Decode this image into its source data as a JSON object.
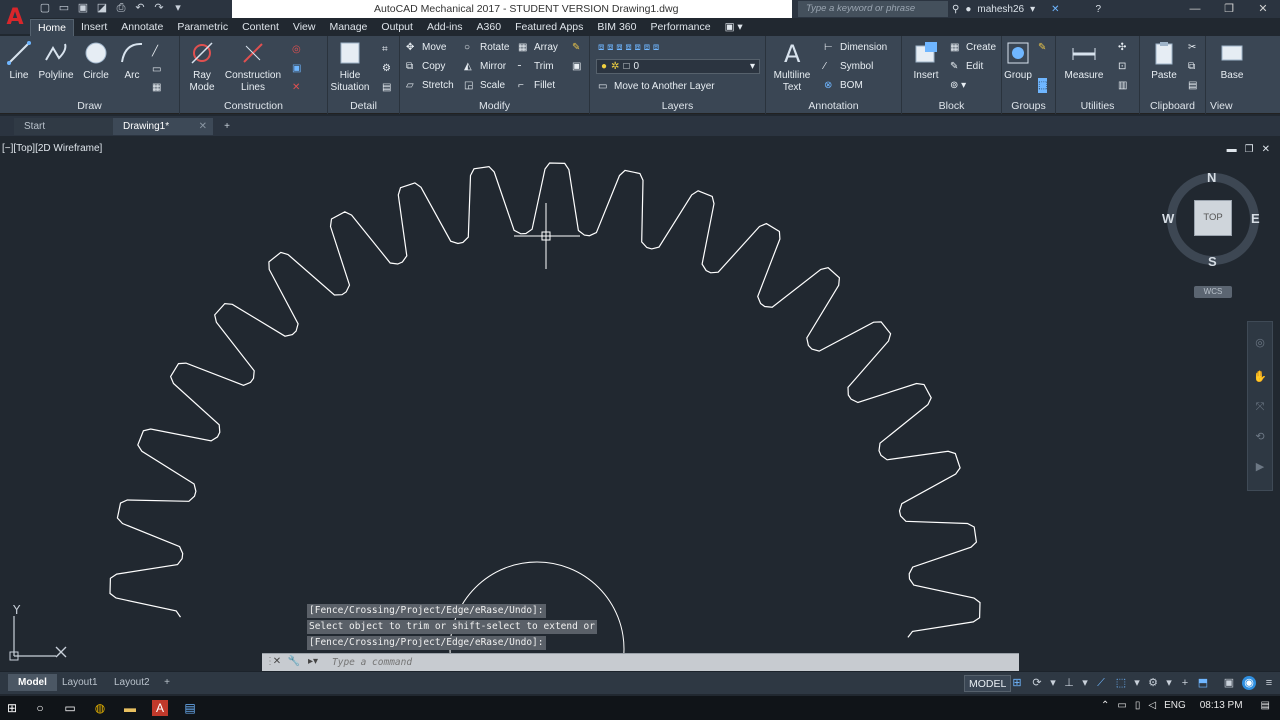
{
  "titlebar": {
    "title": "AutoCAD Mechanical 2017 - STUDENT VERSION    Drawing1.dwg",
    "search_placeholder": "Type a keyword or phrase",
    "username": "mahesh26",
    "app_logo_letter": "A"
  },
  "ribbon_tabs": [
    "Home",
    "Insert",
    "Annotate",
    "Parametric",
    "Content",
    "View",
    "Manage",
    "Output",
    "Add-ins",
    "A360",
    "Featured Apps",
    "BIM 360",
    "Performance"
  ],
  "ribbon": {
    "draw": {
      "title": "Draw",
      "line": "Line",
      "polyline": "Polyline",
      "circle": "Circle",
      "arc": "Arc"
    },
    "construction": {
      "title": "Construction",
      "ray_mode_1": "Ray",
      "ray_mode_2": "Mode",
      "construction_lines_1": "Construction",
      "construction_lines_2": "Lines"
    },
    "detail": {
      "title": "Detail",
      "hide_situation_1": "Hide",
      "hide_situation_2": "Situation"
    },
    "modify": {
      "title": "Modify",
      "move": "Move",
      "rotate": "Rotate",
      "array": "Array",
      "copy": "Copy",
      "mirror": "Mirror",
      "trim": "Trim",
      "stretch": "Stretch",
      "scale": "Scale",
      "fillet": "Fillet"
    },
    "layers": {
      "title": "Layers",
      "current_layer": "0",
      "move_to_layer": "Move to Another Layer"
    },
    "annotation": {
      "title": "Annotation",
      "multiline_text_1": "Multiline",
      "multiline_text_2": "Text",
      "dimension": "Dimension",
      "symbol": "Symbol",
      "bom": "BOM"
    },
    "block": {
      "title": "Block",
      "insert": "Insert",
      "create": "Create",
      "edit": "Edit"
    },
    "groups": {
      "title": "Groups",
      "group": "Group"
    },
    "utilities": {
      "title": "Utilities",
      "measure": "Measure"
    },
    "clipboard": {
      "title": "Clipboard",
      "paste": "Paste"
    },
    "view": {
      "title": "View",
      "base": "Base"
    }
  },
  "file_tabs": {
    "start": "Start",
    "drawing": "Drawing1*"
  },
  "viewport": {
    "label": "[−][Top][2D Wireframe]",
    "viewcube": {
      "top": "TOP",
      "north": "N",
      "south": "S",
      "east": "E",
      "west": "W",
      "wcs": "WCS"
    },
    "ucs_y": "Y"
  },
  "command": {
    "history": [
      "[Fence/Crossing/Project/Edge/eRase/Undo]:",
      "Select object to trim or shift-select to extend or",
      "[Fence/Crossing/Project/Edge/eRase/Undo]:"
    ],
    "placeholder": "Type a command"
  },
  "layout_tabs": [
    "Model",
    "Layout1",
    "Layout2"
  ],
  "status": {
    "model": "MODEL"
  },
  "taskbar": {
    "language": "ENG",
    "time": "08:13 PM"
  },
  "colors": {
    "background": "#212830",
    "ribbon": "#3a4654",
    "geometry": "#ffffff",
    "accent": "#6fb6ff"
  }
}
